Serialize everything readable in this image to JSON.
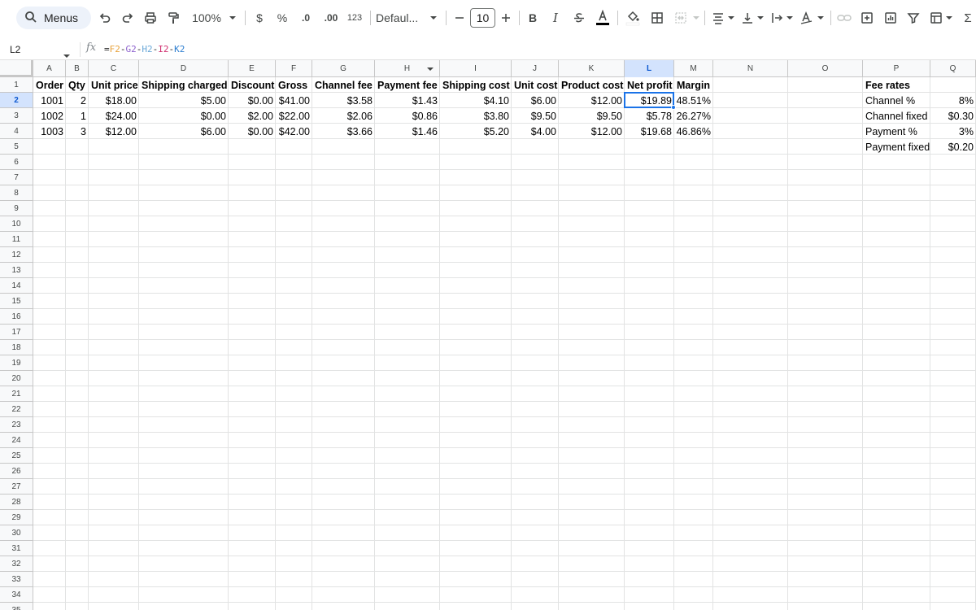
{
  "toolbar": {
    "menus_label": "Menus",
    "zoom": "100%",
    "currency": "$",
    "percent": "%",
    "decrease_decimal": ".0",
    "increase_decimal": ".00",
    "number_format": "123",
    "font_name": "Defaul...",
    "font_size": "10",
    "bold": "B",
    "italic": "I",
    "sigma": "Σ"
  },
  "formula_bar": {
    "name_box": "L2",
    "fx": "fx",
    "formula_parts": [
      "=",
      "F2",
      "-",
      "G2",
      "-",
      "H2",
      "-",
      "I2",
      "-",
      "K2"
    ]
  },
  "selected_cell": "L2",
  "columns": [
    "A",
    "B",
    "C",
    "D",
    "E",
    "F",
    "G",
    "H",
    "I",
    "J",
    "K",
    "L",
    "M",
    "N",
    "O",
    "P",
    "Q"
  ],
  "rows": [
    "1",
    "2",
    "3",
    "4",
    "5",
    "6",
    "7",
    "8",
    "9",
    "10",
    "11",
    "12",
    "13",
    "14",
    "15",
    "16",
    "17",
    "18",
    "19",
    "20",
    "21",
    "22",
    "23",
    "24",
    "25",
    "26",
    "27",
    "28",
    "29",
    "30",
    "31",
    "32",
    "33",
    "34",
    "35"
  ],
  "table": {
    "headers": [
      "Order",
      "Qty",
      "Unit price",
      "Shipping charged",
      "Discount",
      "Gross",
      "Channel fee",
      "Payment fee",
      "Shipping cost",
      "Unit cost",
      "Product cost",
      "Net profit",
      "Margin"
    ],
    "rows": [
      [
        "1001",
        "2",
        "$18.00",
        "$5.00",
        "$0.00",
        "$41.00",
        "$3.58",
        "$1.43",
        "$4.10",
        "$6.00",
        "$12.00",
        "$19.89",
        "48.51%"
      ],
      [
        "1002",
        "1",
        "$24.00",
        "$0.00",
        "$2.00",
        "$22.00",
        "$2.06",
        "$0.86",
        "$3.80",
        "$9.50",
        "$9.50",
        "$5.78",
        "26.27%"
      ],
      [
        "1003",
        "3",
        "$12.00",
        "$6.00",
        "$0.00",
        "$42.00",
        "$3.66",
        "$1.46",
        "$5.20",
        "$4.00",
        "$12.00",
        "$19.68",
        "46.86%"
      ]
    ]
  },
  "fee_rates": {
    "title": "Fee rates",
    "items": [
      {
        "label": "Channel %",
        "value": "8%"
      },
      {
        "label": "Channel fixed",
        "value": "$0.30"
      },
      {
        "label": "Payment %",
        "value": "3%"
      },
      {
        "label": "Payment fixed",
        "value": "$0.20"
      }
    ]
  },
  "colors": {
    "selection": "#1a73e8",
    "header_selected_bg": "#d3e3fd",
    "toolbar_pill": "#edf2fa"
  }
}
